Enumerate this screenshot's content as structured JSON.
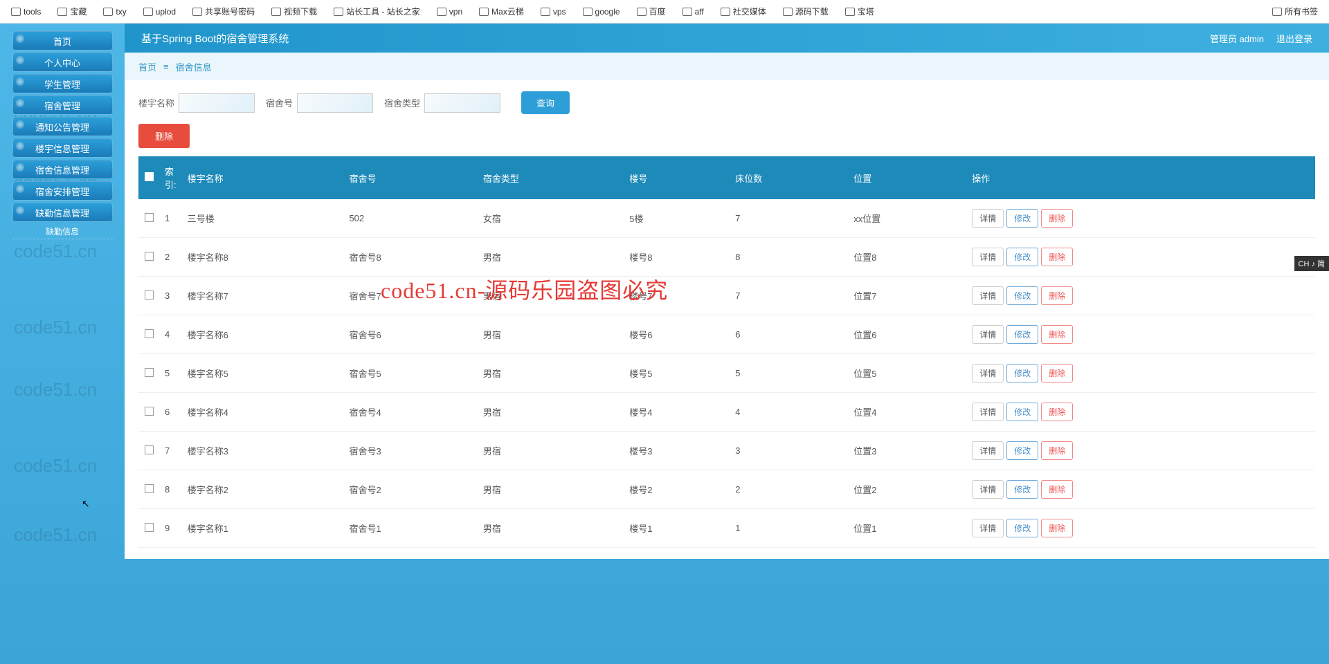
{
  "bookmarks": {
    "items": [
      {
        "label": "tools",
        "icon": "folder"
      },
      {
        "label": "宝藏",
        "icon": "folder"
      },
      {
        "label": "txy",
        "icon": "cloud"
      },
      {
        "label": "uplod",
        "icon": "link"
      },
      {
        "label": "共享账号密码",
        "icon": "sheet"
      },
      {
        "label": "视频下载",
        "icon": "folder"
      },
      {
        "label": "站长工具 - 站长之家",
        "icon": "site"
      },
      {
        "label": "vpn",
        "icon": "folder"
      },
      {
        "label": "Max云梯",
        "icon": "folder"
      },
      {
        "label": "vps",
        "icon": "folder"
      },
      {
        "label": "google",
        "icon": "folder"
      },
      {
        "label": "百度",
        "icon": "baidu"
      },
      {
        "label": "aff",
        "icon": "folder"
      },
      {
        "label": "社交媒体",
        "icon": "folder"
      },
      {
        "label": "源码下载",
        "icon": "folder"
      },
      {
        "label": "宝塔",
        "icon": "folder"
      }
    ],
    "right": {
      "label": "所有书签"
    }
  },
  "header": {
    "title": "基于Spring Boot的宿舍管理系统",
    "admin_label": "管理员 admin",
    "logout": "退出登录"
  },
  "breadcrumb": {
    "home": "首页",
    "sep": "≡",
    "current": "宿舍信息"
  },
  "sidebar": {
    "menus": [
      {
        "label": "首页"
      },
      {
        "label": "个人中心"
      },
      {
        "label": "学生管理"
      },
      {
        "label": "宿舍管理"
      },
      {
        "label": "通知公告管理"
      },
      {
        "label": "楼宇信息管理"
      },
      {
        "label": "宿舍信息管理"
      },
      {
        "label": "宿舍安排管理"
      },
      {
        "label": "缺勤信息管理"
      }
    ],
    "sub": "缺勤信息"
  },
  "search": {
    "building_label": "楼宇名称",
    "dorm_label": "宿舍号",
    "type_label": "宿舍类型",
    "query_btn": "查询",
    "delete_btn": "删除"
  },
  "table": {
    "headers": {
      "index": "索引:",
      "building": "楼宇名称",
      "dormno": "宿舍号",
      "dormtype": "宿舍类型",
      "floorno": "楼号",
      "beds": "床位数",
      "location": "位置",
      "operate": "操作"
    },
    "op": {
      "detail": "详情",
      "edit": "修改",
      "del": "删除"
    },
    "rows": [
      {
        "idx": "1",
        "building": "三号楼",
        "dormno": "502",
        "dormtype": "女宿",
        "floorno": "5楼",
        "beds": "7",
        "location": "xx位置"
      },
      {
        "idx": "2",
        "building": "楼宇名称8",
        "dormno": "宿舍号8",
        "dormtype": "男宿",
        "floorno": "楼号8",
        "beds": "8",
        "location": "位置8"
      },
      {
        "idx": "3",
        "building": "楼宇名称7",
        "dormno": "宿舍号7",
        "dormtype": "男宿",
        "floorno": "楼号7",
        "beds": "7",
        "location": "位置7"
      },
      {
        "idx": "4",
        "building": "楼宇名称6",
        "dormno": "宿舍号6",
        "dormtype": "男宿",
        "floorno": "楼号6",
        "beds": "6",
        "location": "位置6"
      },
      {
        "idx": "5",
        "building": "楼宇名称5",
        "dormno": "宿舍号5",
        "dormtype": "男宿",
        "floorno": "楼号5",
        "beds": "5",
        "location": "位置5"
      },
      {
        "idx": "6",
        "building": "楼宇名称4",
        "dormno": "宿舍号4",
        "dormtype": "男宿",
        "floorno": "楼号4",
        "beds": "4",
        "location": "位置4"
      },
      {
        "idx": "7",
        "building": "楼宇名称3",
        "dormno": "宿舍号3",
        "dormtype": "男宿",
        "floorno": "楼号3",
        "beds": "3",
        "location": "位置3"
      },
      {
        "idx": "8",
        "building": "楼宇名称2",
        "dormno": "宿舍号2",
        "dormtype": "男宿",
        "floorno": "楼号2",
        "beds": "2",
        "location": "位置2"
      },
      {
        "idx": "9",
        "building": "楼宇名称1",
        "dormno": "宿舍号1",
        "dormtype": "男宿",
        "floorno": "楼号1",
        "beds": "1",
        "location": "位置1"
      }
    ]
  },
  "watermark_text": "code51.cn",
  "overlay_text": "code51.cn-源码乐园盗图必究",
  "ime_badge": "CH ♪ 简"
}
